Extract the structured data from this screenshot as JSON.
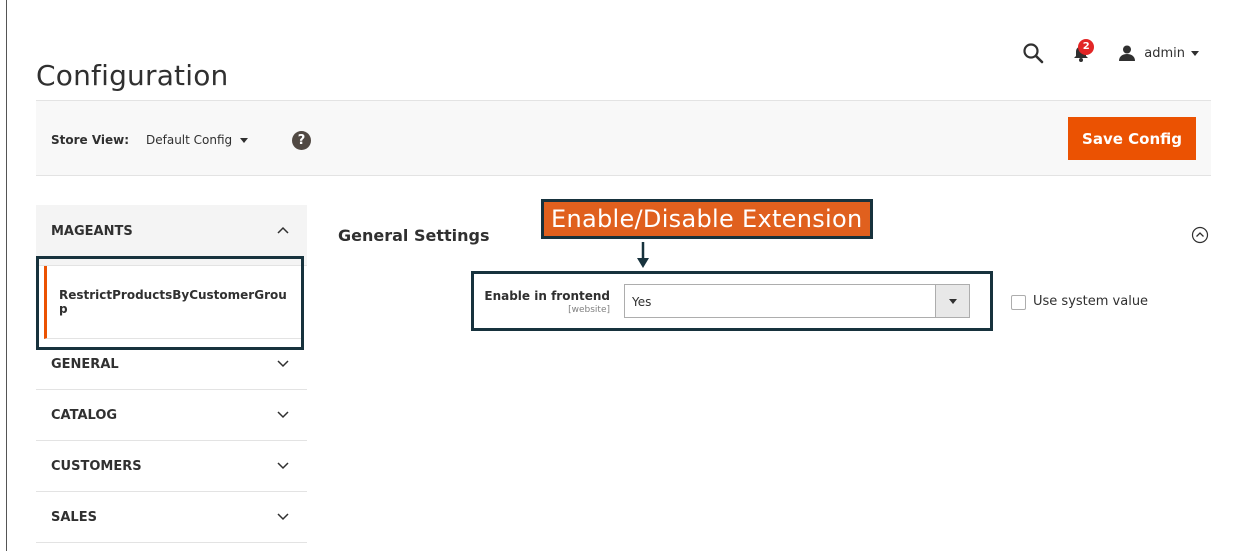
{
  "header": {
    "title": "Configuration",
    "notifications_count": "2",
    "user_name": "admin"
  },
  "store_bar": {
    "label": "Store View:",
    "selected": "Default Config",
    "help_glyph": "?",
    "save_label": "Save Config"
  },
  "sidebar": {
    "sections": [
      {
        "label": "MAGEANTS",
        "expanded": true,
        "items": [
          {
            "label": "RestrictProductsByCustomerGroup"
          }
        ]
      },
      {
        "label": "GENERAL",
        "expanded": false
      },
      {
        "label": "CATALOG",
        "expanded": false
      },
      {
        "label": "CUSTOMERS",
        "expanded": false
      },
      {
        "label": "SALES",
        "expanded": false
      }
    ]
  },
  "main": {
    "section_title": "General Settings",
    "annotation": "Enable/Disable Extension",
    "field": {
      "label": "Enable in frontend",
      "scope": "[website]",
      "value": "Yes",
      "use_system_value_label": "Use system value",
      "use_system_value_checked": false
    }
  },
  "colors": {
    "accent": "#eb5202",
    "annotation_bg": "#e0601e",
    "highlight_border": "#17323d",
    "badge": "#e22626"
  },
  "icons": [
    "search-icon",
    "bell-icon",
    "user-icon",
    "help-icon",
    "chevron-up-icon",
    "chevron-down-icon",
    "collapse-circle-icon",
    "arrow-down-icon"
  ]
}
